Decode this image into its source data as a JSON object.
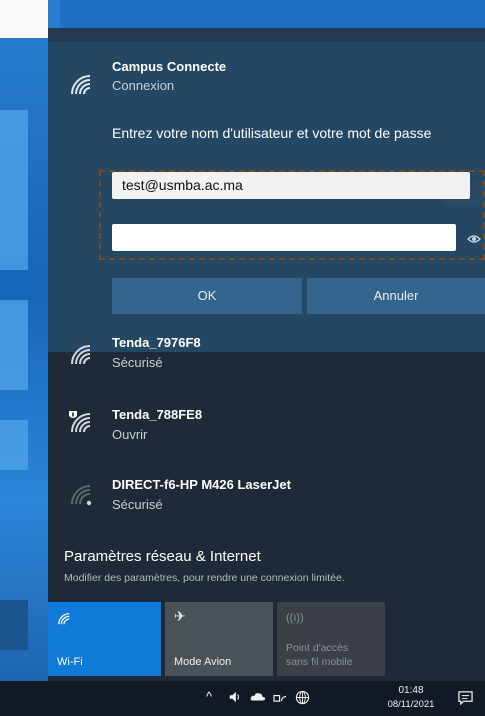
{
  "selected_network": {
    "name": "Campus Connecte",
    "status": "Connexion",
    "prompt": "Entrez votre nom d'utilisateur et votre mot de passe",
    "username_value": "test@usmba.ac.ma",
    "password_value": "",
    "ok_label": "OK",
    "cancel_label": "Annuler"
  },
  "networks": [
    {
      "name": "Tenda_7976F8",
      "status": "Sécurisé",
      "icon": "wifi-icon"
    },
    {
      "name": "Tenda_788FE8",
      "status": "Ouvrir",
      "icon": "wifi-open-shield-icon"
    },
    {
      "name": "DIRECT-f6-HP M426 LaserJet",
      "status": "Sécurisé",
      "icon": "wifi-weak-icon"
    }
  ],
  "settings": {
    "title": "Paramètres réseau & Internet",
    "subtitle": "Modifier des paramètres, pour rendre une connexion limitée."
  },
  "tiles": {
    "wifi": "Wi-Fi",
    "airplane": "Mode Avion",
    "hotspot_line1": "Point d'accès",
    "hotspot_line2": "sans fil mobile"
  },
  "taskbar": {
    "time": "01:48",
    "date": "08/11/2021"
  },
  "colors": {
    "accent": "#0f7ad8",
    "flyout_bg": "#1f2937",
    "selected_bg": "#244863",
    "button_bg": "#33658c"
  }
}
